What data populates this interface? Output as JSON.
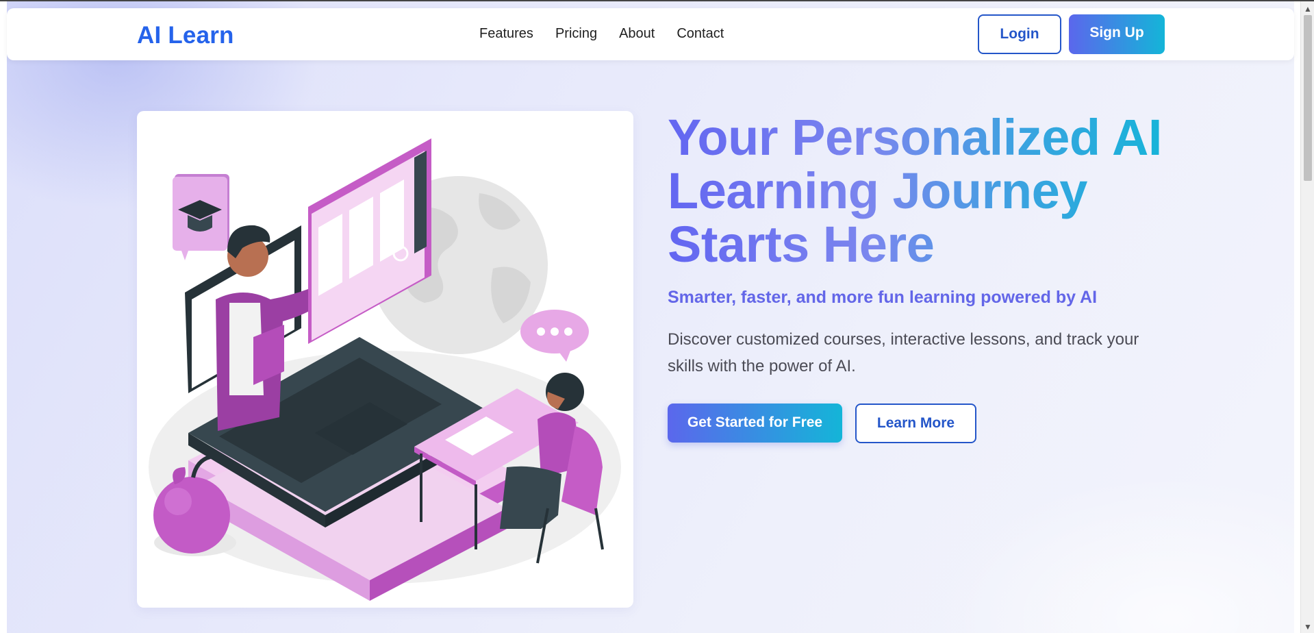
{
  "header": {
    "logo": "AI Learn",
    "nav": [
      {
        "label": "Features"
      },
      {
        "label": "Pricing"
      },
      {
        "label": "About"
      },
      {
        "label": "Contact"
      }
    ],
    "login_label": "Login",
    "signup_label": "Sign Up"
  },
  "hero": {
    "title_lines": [
      "Your Personalized AI",
      "Learning Journey",
      "Starts Here"
    ],
    "subtitle": "Smarter, faster, and more fun learning powered by AI",
    "description": "Discover customized courses, interactive lessons, and track your skills with the power of AI.",
    "cta_primary": "Get Started for Free",
    "cta_secondary": "Learn More",
    "illustration": "online-learning-illustration"
  },
  "colors": {
    "brand": "#2563eb",
    "gradient_start": "#5b67ec",
    "gradient_end": "#14b5d8",
    "accent_purple": "#c060c8",
    "subtitle": "#6366e8"
  },
  "icons": {
    "scroll_up": "▲",
    "scroll_down": "▼"
  }
}
